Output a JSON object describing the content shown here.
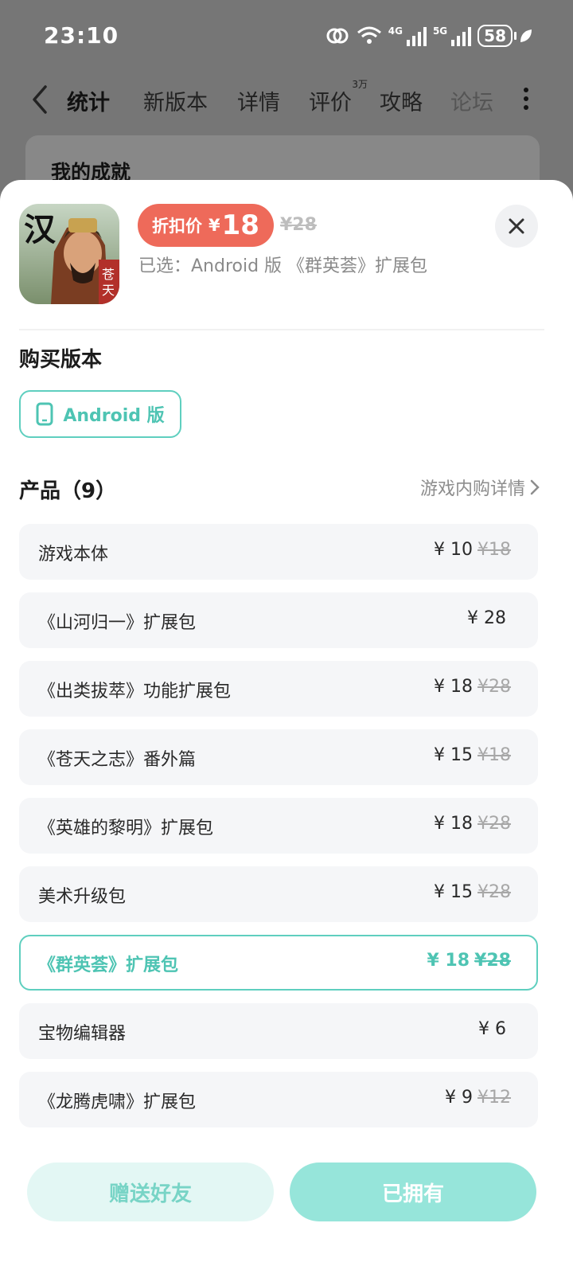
{
  "status_bar": {
    "time": "23:10",
    "net1": "4G",
    "net2": "5G",
    "battery": "58"
  },
  "top_nav": {
    "tabs": [
      {
        "label": "统计",
        "active": true
      },
      {
        "label": "新版本"
      },
      {
        "label": "详情"
      },
      {
        "label": "评价",
        "badge": "3万"
      },
      {
        "label": "攻略"
      },
      {
        "label": "论坛"
      }
    ]
  },
  "behind_card": {
    "title": "我的成就"
  },
  "sheet": {
    "app_icon_text": [
      "汉",
      "苍天"
    ],
    "discount_label": "折扣价",
    "currency": "¥",
    "discount_price": "18",
    "original_price": "¥28",
    "selected_text": "已选：Android 版 《群英荟》扩展包",
    "version_section_title": "购买版本",
    "version_button": "Android 版",
    "products_title": "产品（9）",
    "products_link": "游戏内购详情",
    "products": [
      {
        "name": "游戏本体",
        "price": "¥ 10",
        "old": "¥18"
      },
      {
        "name": "《山河归一》扩展包",
        "price": "¥ 28",
        "old": ""
      },
      {
        "name": "《出类拔萃》功能扩展包",
        "price": "¥ 18",
        "old": "¥28"
      },
      {
        "name": "《苍天之志》番外篇",
        "price": "¥ 15",
        "old": "¥18"
      },
      {
        "name": "《英雄的黎明》扩展包",
        "price": "¥ 18",
        "old": "¥28"
      },
      {
        "name": "美术升级包",
        "price": "¥ 15",
        "old": "¥28"
      },
      {
        "name": "《群英荟》扩展包",
        "price": "¥ 18",
        "old": "¥28",
        "selected": true
      },
      {
        "name": "宝物编辑器",
        "price": "¥ 6",
        "old": ""
      },
      {
        "name": "《龙腾虎啸》扩展包",
        "price": "¥ 9",
        "old": "¥12"
      }
    ],
    "gift_button": "赠送好友",
    "owned_button": "已拥有"
  },
  "colors": {
    "accent": "#5fcfbf",
    "discount": "#ee6a5a",
    "owned_bg": "#96e5da",
    "gift_bg": "#e3f7f4"
  }
}
